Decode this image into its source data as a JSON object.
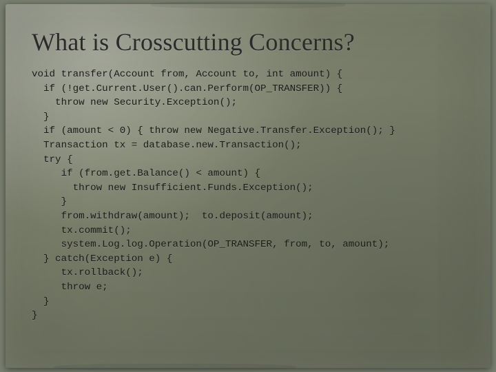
{
  "slide": {
    "title": "What is Crosscutting Concerns?",
    "code_lines": [
      "void transfer(Account from, Account to, int amount) {",
      "  if (!get.Current.User().can.Perform(OP_TRANSFER)) {",
      "    throw new Security.Exception();",
      "  }",
      "  if (amount < 0) { throw new Negative.Transfer.Exception(); }",
      "  Transaction tx = database.new.Transaction();",
      "  try {",
      "     if (from.get.Balance() < amount) {",
      "       throw new Insufficient.Funds.Exception();",
      "     }",
      "     from.withdraw(amount);  to.deposit(amount);",
      "     tx.commit();",
      "     system.Log.log.Operation(OP_TRANSFER, from, to, amount);",
      "  } catch(Exception e) {",
      "     tx.rollback();",
      "     throw e;",
      "  }",
      "}"
    ]
  }
}
